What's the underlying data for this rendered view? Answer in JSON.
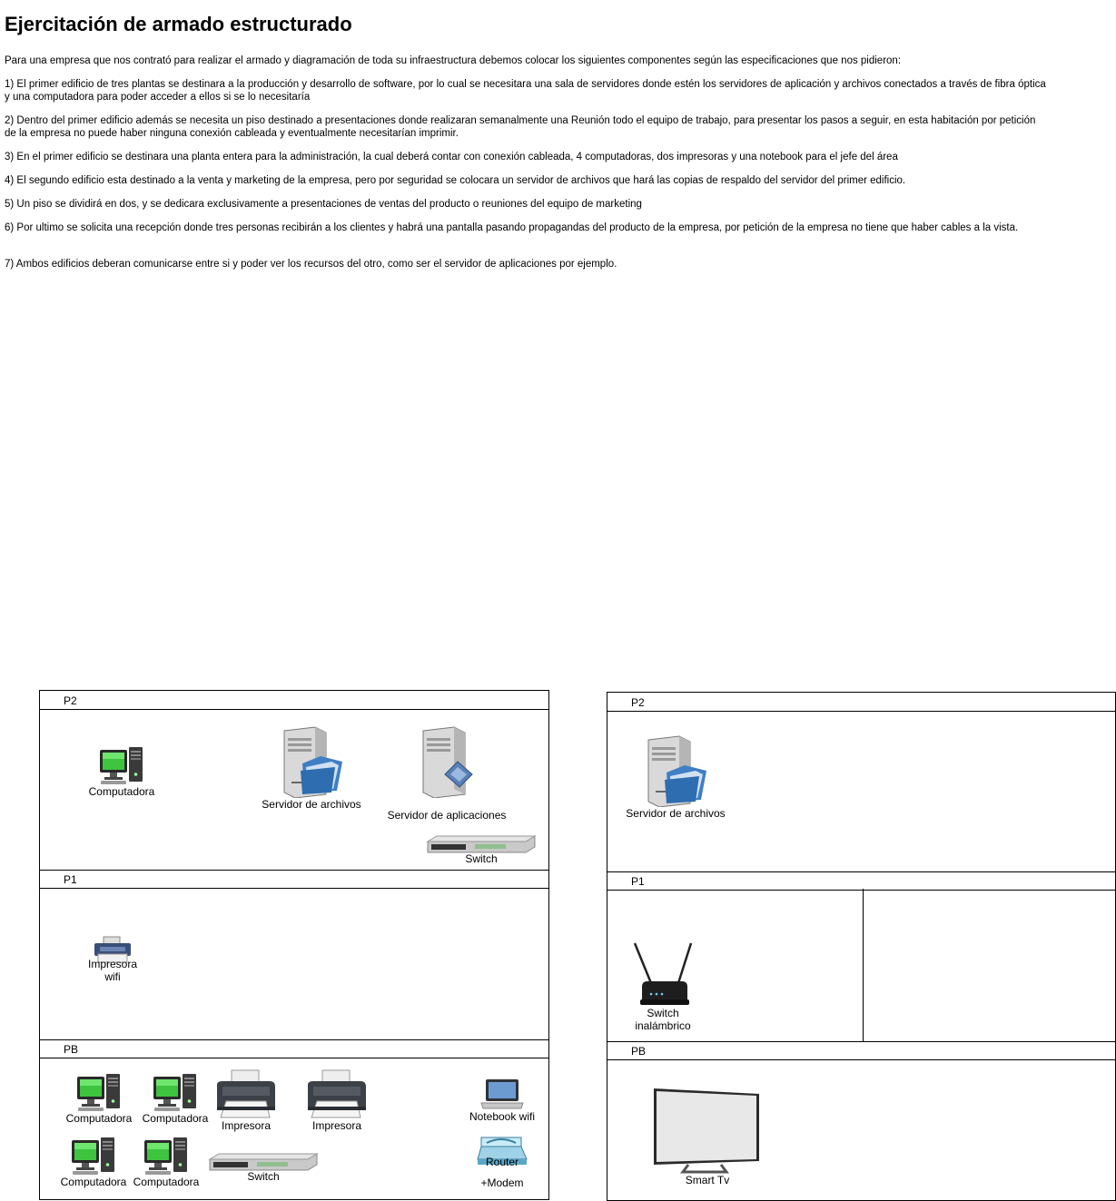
{
  "title": "Ejercitación de armado estructurado",
  "paragraphs": [
    "Para una empresa que  nos contrató para realizar el armado y diagramación de toda su infraestructura debemos colocar los siguientes componentes según las especificaciones que nos pidieron:",
    "1) El primer edificio de tres plantas se destinara a la producción y desarrollo de software, por lo cual se necesitara una sala de servidores donde estén los servidores de aplicación y archivos conectados a través de fibra óptica y una computadora para poder acceder a ellos si se lo necesitaría",
    "2) Dentro del primer edificio además se necesita un piso destinado a presentaciones donde realizaran semanalmente una Reunión todo el equipo de trabajo, para presentar los pasos a seguir, en esta habitación por petición de la empresa no puede haber ninguna conexión cableada y eventualmente necesitarían imprimir.",
    "3) En el primer edificio se destinara una planta entera para la administración, la cual deberá contar con conexión cableada, 4 computadoras, dos impresoras y una notebook para el jefe del área",
    "4) El segundo edificio esta destinado a la venta y marketing de la empresa, pero por seguridad se colocara un servidor de archivos que hará las copias de respaldo del servidor del primer edificio.",
    "5) Un piso se dividirá en dos, y se dedicara exclusivamente a presentaciones de ventas del producto o reuniones del equipo de marketing",
    "6) Por ultimo se solicita una recepción donde tres personas recibirán a los clientes y habrá una pantalla pasando propagandas del producto de la empresa, por petición de la empresa no tiene que haber cables a la vista.",
    "7) Ambos edificios deberan comunicarse entre si y poder ver los recursos del otro, como ser el servidor de aplicaciones por ejemplo."
  ],
  "building1": {
    "floors": [
      "P2",
      "P1",
      "PB"
    ],
    "p2": {
      "computer": "Computadora",
      "file_server": "Servidor de archivos",
      "app_server": "Servidor de aplicaciones",
      "switch": "Switch"
    },
    "p1": {
      "printer_wifi": "Impresora\nwifi"
    },
    "pb": {
      "computers": [
        "Computadora",
        "Computadora",
        "Computadora",
        "Computadora"
      ],
      "printers": [
        "Impresora",
        "Impresora"
      ],
      "switch": "Switch",
      "notebook": "Notebook wifi",
      "router": "Router",
      "modem": "+Modem"
    }
  },
  "building2": {
    "floors": [
      "P2",
      "P1",
      "PB"
    ],
    "p2": {
      "file_server": "Servidor de archivos"
    },
    "p1": {
      "wireless_switch": "Switch\ninalámbrico"
    },
    "pb": {
      "smart_tv": "Smart Tv"
    }
  }
}
